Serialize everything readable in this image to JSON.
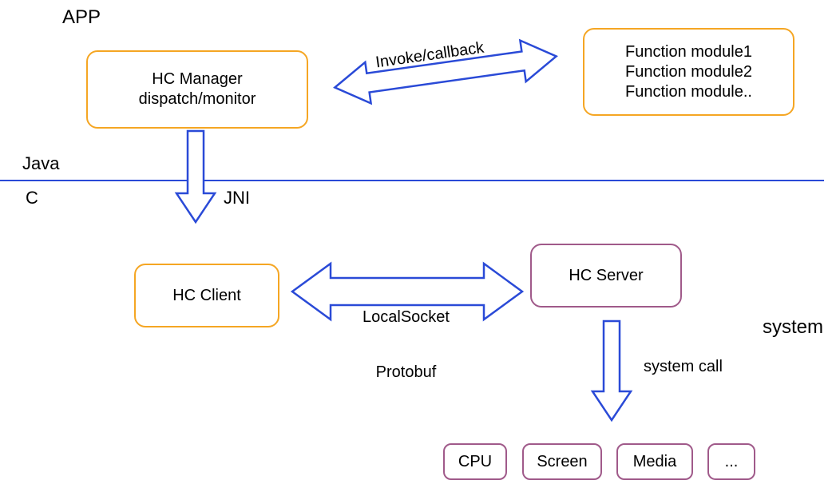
{
  "title_app": "APP",
  "title_system": "system",
  "layer_java": "Java",
  "layer_c": "C",
  "layer_jni": "JNI",
  "boxes": {
    "hc_manager_l1": "HC Manager",
    "hc_manager_l2": "dispatch/monitor",
    "func_mod_l1": "Function module1",
    "func_mod_l2": "Function module2",
    "func_mod_l3": "Function module..",
    "hc_client": "HC Client",
    "hc_server": "HC Server",
    "cpu": "CPU",
    "screen": "Screen",
    "media": "Media",
    "more": "..."
  },
  "arrows": {
    "invoke_callback": "Invoke/callback",
    "localsocket_l1": "LocalSocket",
    "localsocket_l2": "Protobuf",
    "system_call": "system call"
  },
  "colors": {
    "blue": "#2a4ad7",
    "orange": "#f5a623",
    "purple": "#a05a8a"
  }
}
